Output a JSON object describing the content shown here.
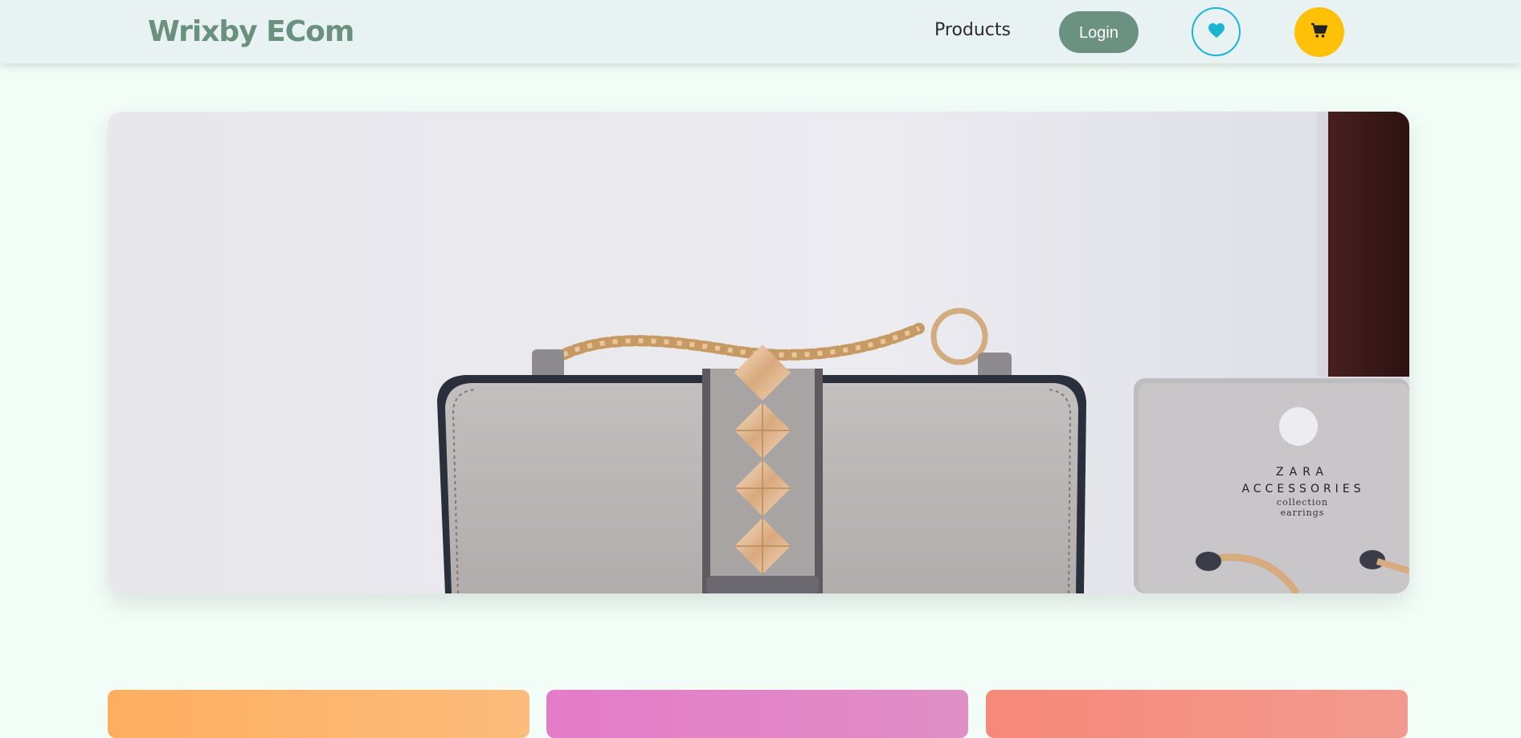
{
  "header": {
    "brand": "Wrixby ECom",
    "nav_products": "Products",
    "login_label": "Login",
    "wishlist_icon": "heart-icon",
    "cart_icon": "cart-icon",
    "accent_colors": {
      "brand": "#6a917d",
      "login": "#6b9180",
      "wishlist": "#1ab5d3",
      "cart": "#ffc107"
    }
  },
  "hero": {
    "image_subject": "grey studded chain handbag with earrings card",
    "card_lines": [
      "ZARA",
      "ACCESSORIES",
      "collection",
      "earrings"
    ]
  },
  "categories": {
    "card_colors": [
      "#fdae60",
      "#e47bc8",
      "#f6897a"
    ]
  }
}
